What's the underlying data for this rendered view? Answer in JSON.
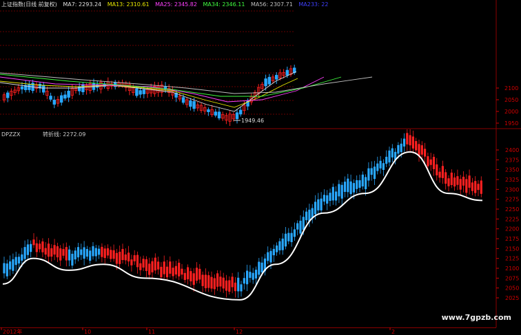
{
  "price_legend": {
    "title": "上证指数(日线 前复权)",
    "ma7": "MA7: 2293.24",
    "ma13": "MA13: 2310.61",
    "ma25": "MA25: 2345.82",
    "ma34": "MA34: 2346.11",
    "ma56": "MA56: 2307.71",
    "ma233": "MA233: 22"
  },
  "indicator_legend": {
    "name": "DPZZX",
    "turn_line": "转折线: 2272.09"
  },
  "low_marker": "1949.46",
  "watermark": "www.7gpzb.com",
  "colors": {
    "up": "#ff2020",
    "down": "#29a8ff",
    "turn_line": "#ffffff",
    "grid": "#8b0000",
    "axis_text": "#d00000",
    "ma7": "#e0e0e0",
    "ma13": "#e8e800",
    "ma25": "#ff40ff",
    "ma34": "#40ff40",
    "ma56": "#c0c0c0",
    "ma233": "#4040ff"
  },
  "price_axis_ticks": [
    "2100",
    "2050",
    "2000",
    "1950"
  ],
  "indicator_axis_ticks": [
    "2400",
    "2375",
    "2350",
    "2325",
    "2300",
    "2275",
    "2250",
    "2225",
    "2200",
    "2175",
    "2150",
    "2125",
    "2100",
    "2075",
    "2050",
    "2025"
  ],
  "date_labels": [
    "2012年",
    "10",
    "11",
    "12",
    "2"
  ],
  "chart_data": {
    "type": "line",
    "title": "转折线",
    "xlabel": "",
    "ylabel": "",
    "ylim": [
      2000,
      2430
    ],
    "x": [
      "2012年",
      "10",
      "11",
      "12",
      "2"
    ],
    "series": [
      {
        "name": "转折线",
        "values": [
          2060,
          2125,
          2095,
          2110,
          2075,
          2020,
          2110,
          2240,
          2290,
          2395,
          2290,
          2272
        ]
      }
    ]
  }
}
